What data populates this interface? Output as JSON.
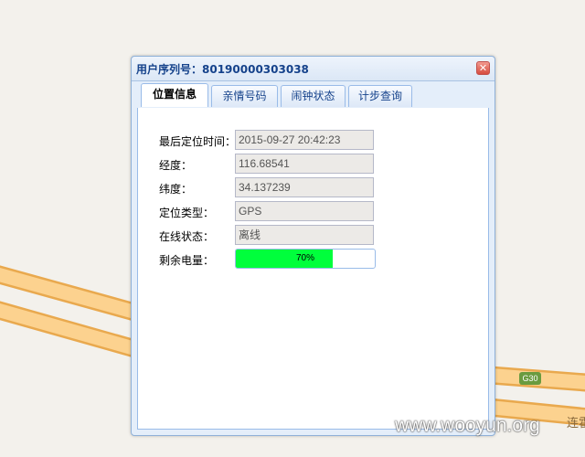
{
  "dialog": {
    "title": "用户序列号：80190000303038",
    "close_glyph": "✕"
  },
  "tabs": [
    {
      "label": "位置信息",
      "active": true
    },
    {
      "label": "亲情号码",
      "active": false
    },
    {
      "label": "闹钟状态",
      "active": false
    },
    {
      "label": "计步查询",
      "active": false
    }
  ],
  "fields": {
    "last_location_time": {
      "label": "最后定位时间：",
      "value": "2015-09-27 20:42:23"
    },
    "longitude": {
      "label": "经度：",
      "value": "116.68541"
    },
    "latitude": {
      "label": "纬度：",
      "value": "34.137239"
    },
    "location_type": {
      "label": "定位类型：",
      "value": "GPS"
    },
    "online_status": {
      "label": "在线状态：",
      "value": "离线"
    },
    "battery": {
      "label": "剩余电量：",
      "text": "70%",
      "percent": 70
    }
  },
  "map": {
    "highway_badge": "G30",
    "road_name": "连霍",
    "watermark": "www.wooyun.org"
  },
  "colors": {
    "title": "#15428b",
    "battery_fill": "#00ff3c",
    "road_fill": "#fcd28f",
    "road_edge": "#e9a94e",
    "map_bg": "#f3f1ec"
  }
}
